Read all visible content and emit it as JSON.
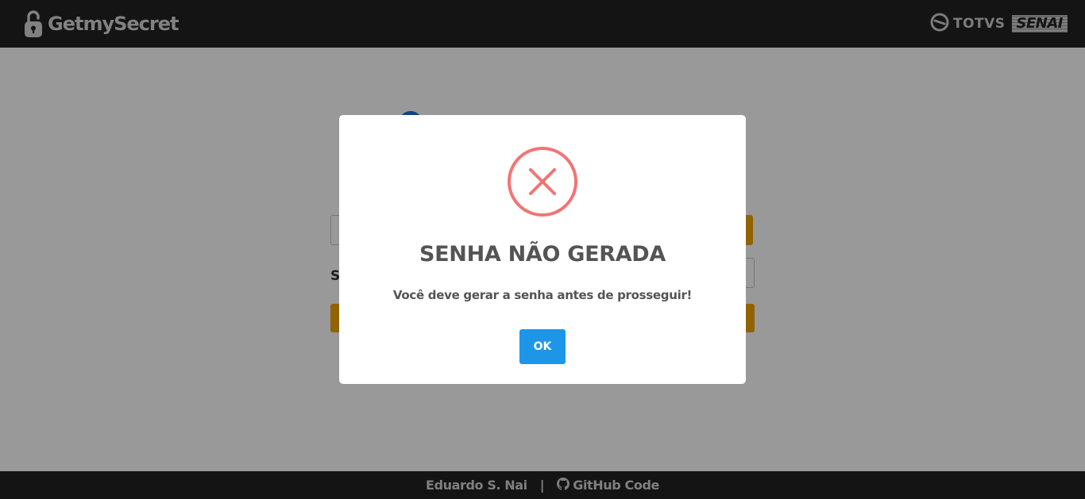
{
  "header": {
    "brand_name": "GetmySecret",
    "brand_icon": "unlocked-padlock-icon",
    "partners": {
      "totvs": "TOTVS",
      "senai": "SENAI"
    }
  },
  "background": {
    "label": "S"
  },
  "modal": {
    "icon": "error-x-icon",
    "title": "SENHA NÃO GERADA",
    "message": "Você deve gerar a senha antes de prosseguir!",
    "ok_label": "OK"
  },
  "footer": {
    "author": "Eduardo S. Nai",
    "separator": "|",
    "github_label": "GitHub Code"
  },
  "colors": {
    "header_bg": "#222222",
    "accent_blue": "#1e96e8",
    "error_red": "#f27474",
    "warning_gold": "#f5a300"
  }
}
